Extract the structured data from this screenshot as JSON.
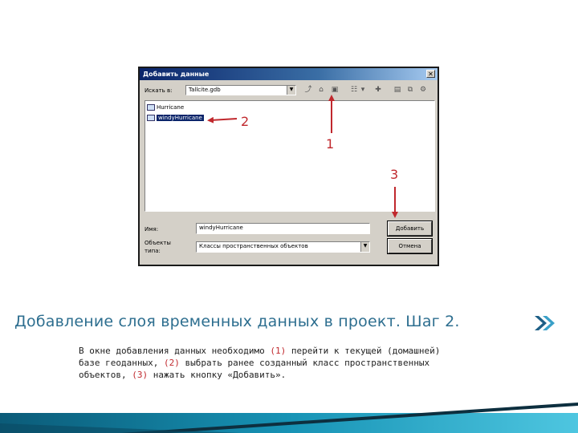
{
  "dialog": {
    "title": "Добавить данные",
    "close_glyph": "✕",
    "look_in_label": "Искать в:",
    "look_in_value": "Tallcite.gdb",
    "files": [
      {
        "name": "Hurricane"
      },
      {
        "name": "windyHurricane"
      }
    ],
    "name_label": "Имя:",
    "name_value": "windyHurricane",
    "type_label_1": "Объекты",
    "type_label_2": "типа:",
    "type_value": "Классы пространственных объектов",
    "add_button": "Добавить",
    "cancel_button": "Отмена"
  },
  "annotations": {
    "one": "1",
    "two": "2",
    "three": "3"
  },
  "caption": {
    "heading": "Добавление слоя временных данных в проект. Шаг 2.",
    "line1_a": "В окне добавления данных необходимо ",
    "m1": "(1)",
    "line1_b": " перейти к текущей (домашней)",
    "line2_a": "базе геоданных, ",
    "m2": "(2)",
    "line2_b": " выбрать ранее созданный класс пространственных",
    "line3_a": "объектов, ",
    "m3": "(3)",
    "line3_b": " нажать кнопку «Добавить»."
  },
  "colors": {
    "accent_red": "#c0282d",
    "heading_blue": "#2d6e8f",
    "title_bar": "#0a246a"
  }
}
